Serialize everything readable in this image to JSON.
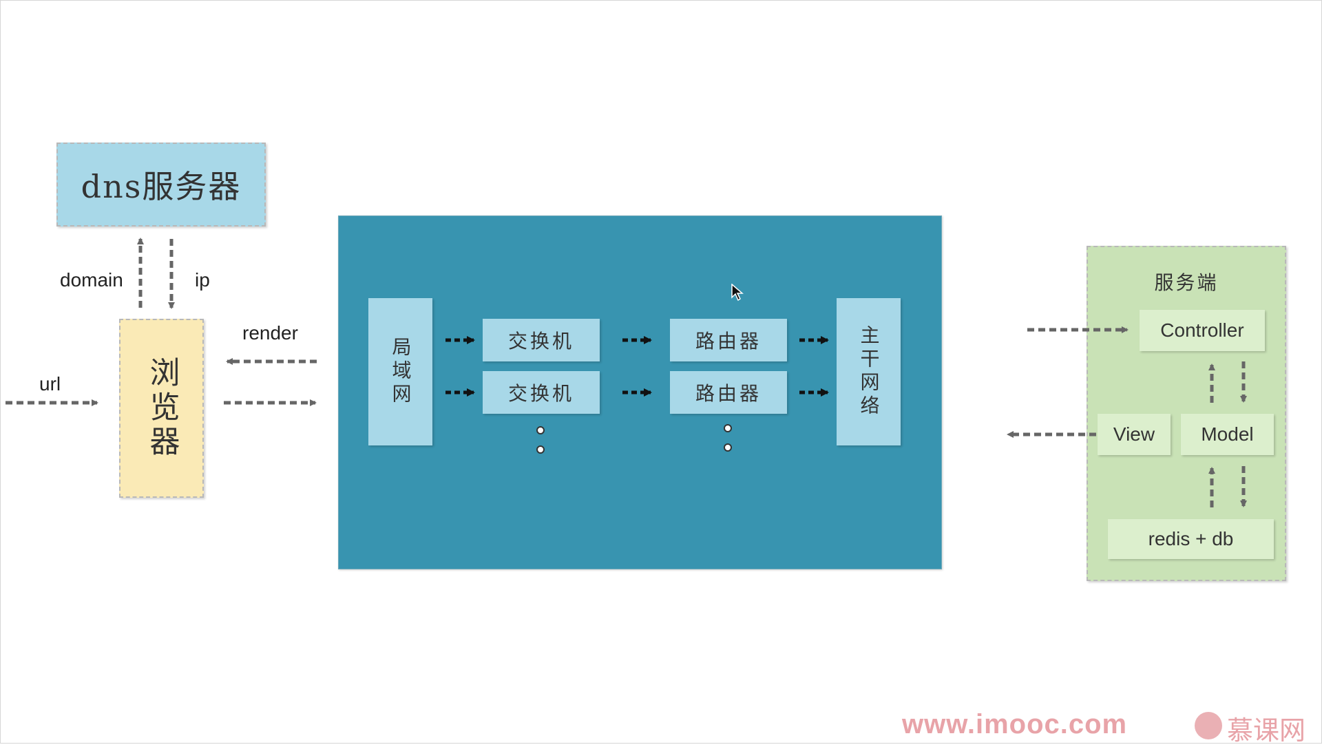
{
  "dns_server": {
    "label": "dns服务器"
  },
  "browser": {
    "label": "浏览器"
  },
  "labels": {
    "domain": "domain",
    "ip": "ip",
    "url": "url",
    "render": "render"
  },
  "network": {
    "lan": "局域网",
    "switches": [
      "交换机",
      "交换机"
    ],
    "routers": [
      "路由器",
      "路由器"
    ],
    "backbone": "主干网络"
  },
  "server": {
    "title": "服务端",
    "controller": "Controller",
    "view": "View",
    "model": "Model",
    "storage": "redis + db"
  },
  "watermark": {
    "url": "www.imooc.com",
    "brand": "慕课网"
  },
  "colors": {
    "dns_fill": "#a8d8e8",
    "browser_fill": "#faeab6",
    "network_fill": "#3894b0",
    "server_fill": "#c9e2b6",
    "arrow": "#666666"
  }
}
